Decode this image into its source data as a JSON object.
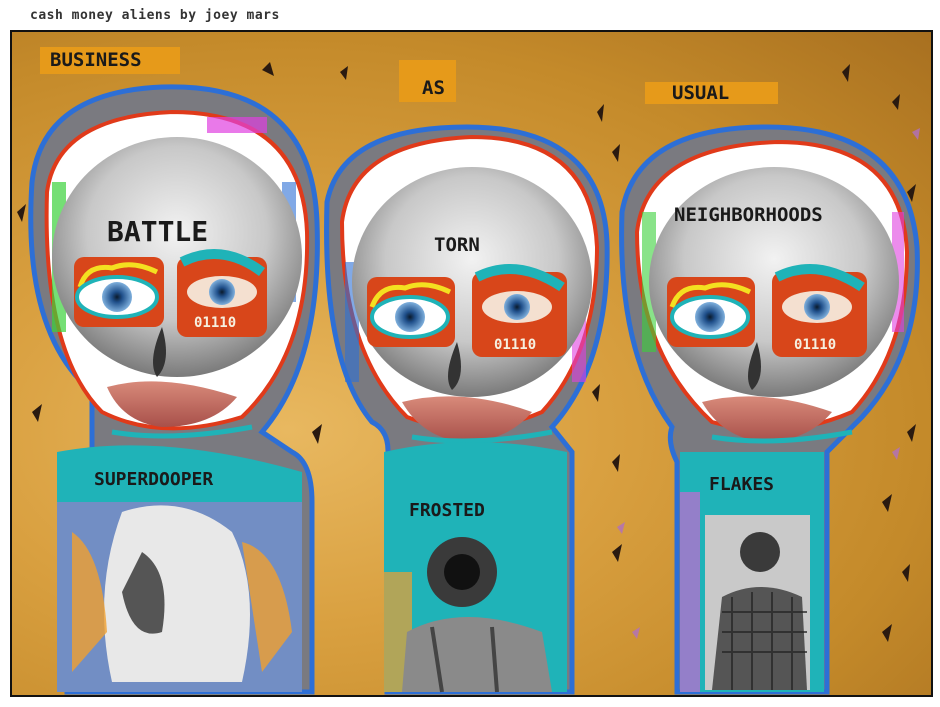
{
  "caption": "cash money aliens by joey mars",
  "headline": [
    "BUSINESS",
    "AS",
    "USUAL"
  ],
  "figures": [
    {
      "forehead": "BATTLE",
      "eye_tag": "01110",
      "body": "SUPERDOOPER"
    },
    {
      "forehead": "TORN",
      "eye_tag": "01110",
      "body": "FROSTED"
    },
    {
      "forehead": "NEIGHBORHOODS",
      "eye_tag": "01110",
      "body": "FLAKES"
    }
  ],
  "colors": {
    "background": "#d9a040",
    "outline_blue": "#2d6fd6",
    "outline_red": "#e03a1a",
    "body_teal": "#1fb3b8",
    "eye_patch": "#d8461a",
    "label_bar": "#e69a1a"
  }
}
